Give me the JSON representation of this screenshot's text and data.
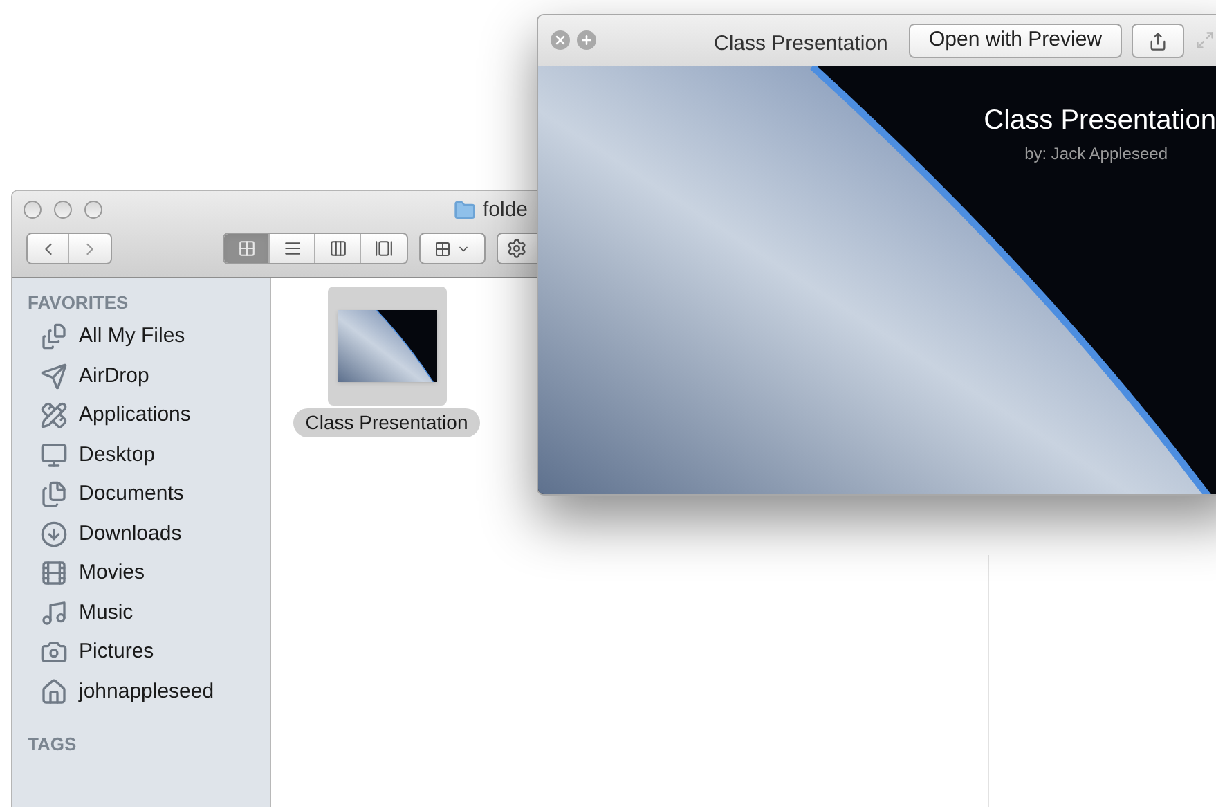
{
  "finder": {
    "title": "folde",
    "view_modes": [
      {
        "selected": true
      },
      {
        "selected": false
      },
      {
        "selected": false
      },
      {
        "selected": false
      }
    ],
    "sidebar": {
      "sections": [
        {
          "heading": "FAVORITES",
          "items": [
            {
              "label": "All My Files"
            },
            {
              "label": "AirDrop"
            },
            {
              "label": "Applications"
            },
            {
              "label": "Desktop"
            },
            {
              "label": "Documents"
            },
            {
              "label": "Downloads"
            },
            {
              "label": "Movies"
            },
            {
              "label": "Music"
            },
            {
              "label": "Pictures"
            },
            {
              "label": "johnappleseed"
            }
          ]
        },
        {
          "heading": "TAGS"
        }
      ]
    },
    "files": [
      {
        "name": "Class Presentation",
        "selected": true
      }
    ]
  },
  "quick_look": {
    "title": "Class Presentation",
    "open_button": "Open with Preview",
    "slide": {
      "title": "Class Presentation",
      "subtitle": "by: Jack Appleseed"
    }
  }
}
